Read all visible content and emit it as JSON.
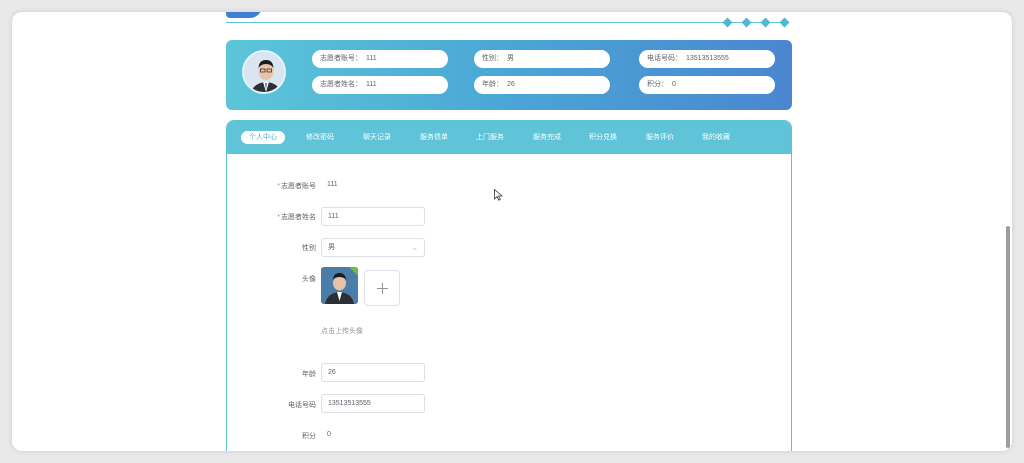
{
  "profile": {
    "account_label": "志愿者账号：",
    "account_value": "111",
    "gender_label": "性别：",
    "gender_value": "男",
    "phone_label": "电话号码：",
    "phone_value": "13513513555",
    "name_label": "志愿者姓名：",
    "name_value": "111",
    "age_label": "年龄：",
    "age_value": "26",
    "points_label": "积分：",
    "points_value": "0"
  },
  "tabs": [
    {
      "label": "个人中心",
      "active": true
    },
    {
      "label": "修改密码",
      "active": false
    },
    {
      "label": "聊天记录",
      "active": false
    },
    {
      "label": "服务债单",
      "active": false
    },
    {
      "label": "上门服务",
      "active": false
    },
    {
      "label": "服务完成",
      "active": false
    },
    {
      "label": "积分兑换",
      "active": false
    },
    {
      "label": "服务评价",
      "active": false
    },
    {
      "label": "我的收藏",
      "active": false
    }
  ],
  "form": {
    "required_mark": "*",
    "account_label": "志愿者账号",
    "account_value": "111",
    "name_label": "志愿者姓名",
    "name_value": "111",
    "gender_label": "性别",
    "gender_value": "男",
    "avatar_label": "头像",
    "upload_hint": "点击上传头像",
    "age_label": "年龄",
    "age_value": "26",
    "phone_label": "电话号码",
    "phone_value": "13513513555",
    "points_label": "积分",
    "points_value": "0"
  },
  "icons": {
    "chevron": "chevron-down-icon",
    "plus": "plus-icon",
    "check": "check-icon",
    "cursor": "mouse-cursor-icon"
  },
  "colors": {
    "accent": "#5fc4d7",
    "banner_end": "#4a86d0",
    "required": "#f56c6c"
  }
}
